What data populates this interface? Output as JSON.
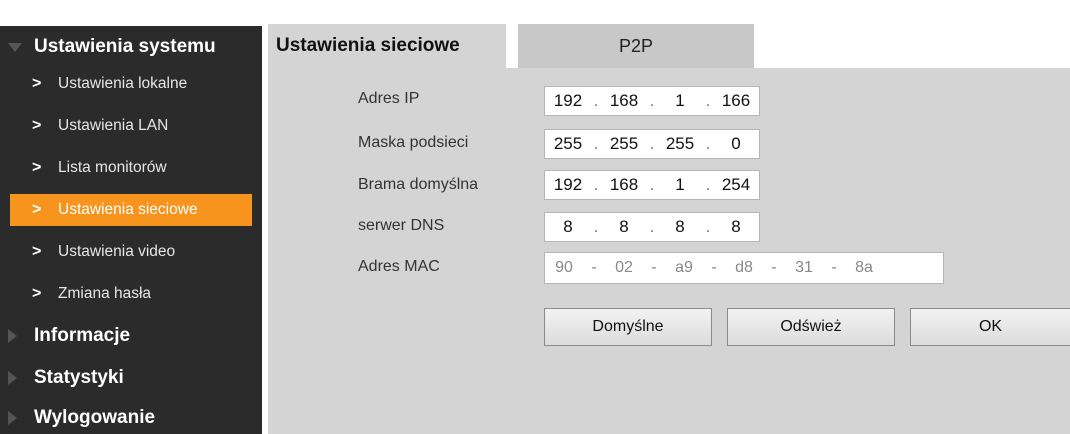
{
  "sidebar": {
    "sections": [
      {
        "label": "Ustawienia systemu",
        "icon": "triangle-down-icon"
      },
      {
        "label": "Informacje",
        "icon": "triangle-right-icon"
      },
      {
        "label": "Statystyki",
        "icon": "triangle-right-icon"
      },
      {
        "label": "Wylogowanie",
        "icon": "triangle-right-icon"
      }
    ],
    "items": [
      {
        "label": "Ustawienia lokalne"
      },
      {
        "label": "Ustawienia LAN"
      },
      {
        "label": "Lista monitorów"
      },
      {
        "label": "Ustawienia sieciowe",
        "active": true
      },
      {
        "label": "Ustawienia video"
      },
      {
        "label": "Zmiana hasła"
      }
    ],
    "chevron": ">"
  },
  "tabs": [
    {
      "label": "Ustawienia sieciowe",
      "active": true
    },
    {
      "label": "P2P",
      "active": false
    }
  ],
  "form": {
    "ip": {
      "label": "Adres IP",
      "octets": [
        "192",
        "168",
        "1",
        "166"
      ]
    },
    "mask": {
      "label": "Maska podsieci",
      "octets": [
        "255",
        "255",
        "255",
        "0"
      ]
    },
    "gateway": {
      "label": "Brama domyślna",
      "octets": [
        "192",
        "168",
        "1",
        "254"
      ]
    },
    "dns": {
      "label": "serwer DNS",
      "octets": [
        "8",
        "8",
        "8",
        "8"
      ]
    },
    "mac": {
      "label": "Adres MAC",
      "octets": [
        "90",
        "02",
        "a9",
        "d8",
        "31",
        "8a"
      ]
    },
    "separator": ".",
    "mac_separator": "-"
  },
  "buttons": {
    "default_label": "Domyślne",
    "refresh_label": "Odśwież",
    "ok_label": "OK"
  },
  "colors": {
    "sidebar_bg": "#2b2b2b",
    "active_item": "#f7941d",
    "panel_bg": "#d4d4d4"
  }
}
